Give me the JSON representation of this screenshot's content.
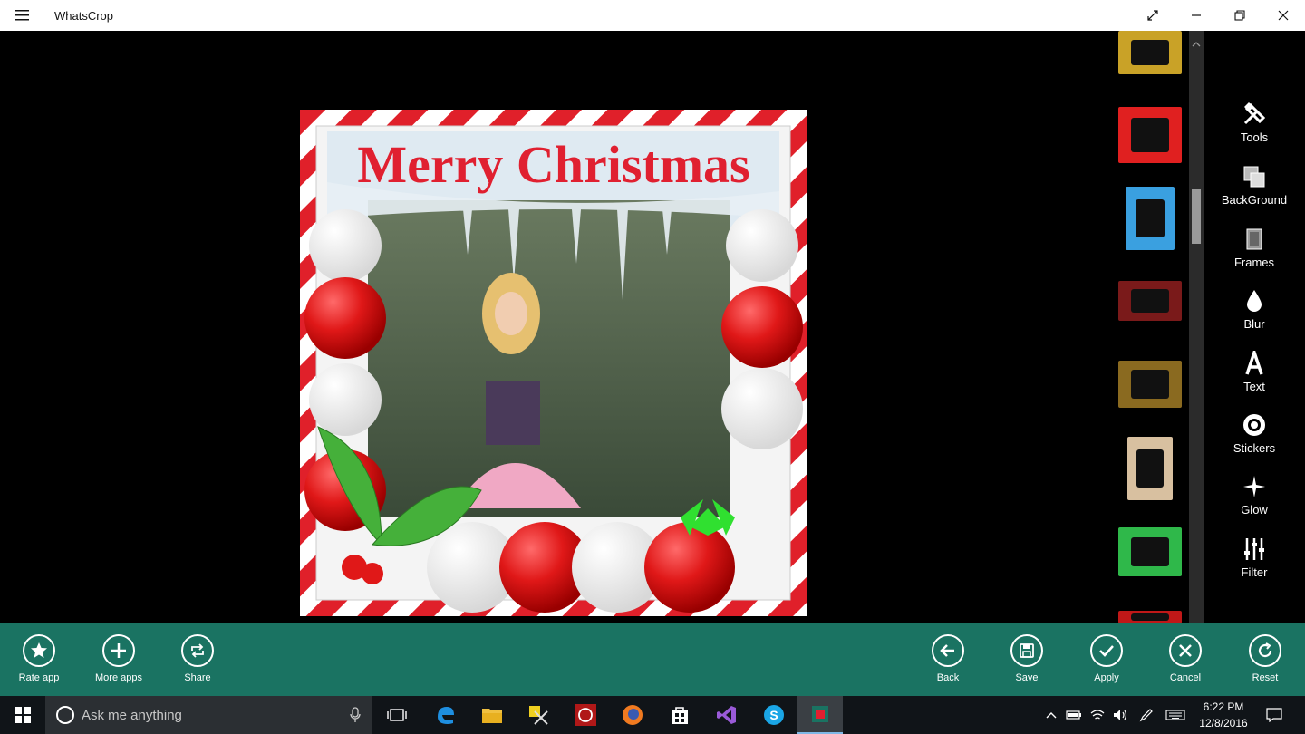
{
  "app": {
    "title": "WhatsCrop"
  },
  "photo": {
    "caption": "Merry Christmas"
  },
  "frames": {
    "thumbnails": [
      {
        "name": "gold-frame",
        "color": "#c9a227"
      },
      {
        "name": "merry-christmas-frame",
        "color": "#e02020"
      },
      {
        "name": "balloons-frame",
        "color": "#3aa0e0"
      },
      {
        "name": "holly-frame",
        "color": "#7a1a1a"
      },
      {
        "name": "ornate-gold-frame",
        "color": "#8a6a20"
      },
      {
        "name": "oval-frame",
        "color": "#d8c0a0"
      },
      {
        "name": "green-border-frame",
        "color": "#2fb84a"
      },
      {
        "name": "red-frame",
        "color": "#c01818"
      }
    ]
  },
  "tools": {
    "items": [
      {
        "label": "Tools",
        "icon": "tools-icon"
      },
      {
        "label": "BackGround",
        "icon": "background-icon"
      },
      {
        "label": "Frames",
        "icon": "frames-icon"
      },
      {
        "label": "Blur",
        "icon": "blur-icon"
      },
      {
        "label": "Text",
        "icon": "text-icon"
      },
      {
        "label": "Stickers",
        "icon": "stickers-icon"
      },
      {
        "label": "Glow",
        "icon": "glow-icon"
      },
      {
        "label": "Filter",
        "icon": "filter-icon"
      }
    ]
  },
  "appbar": {
    "left": [
      {
        "label": "Rate app",
        "icon": "star-icon"
      },
      {
        "label": "More apps",
        "icon": "plus-icon"
      },
      {
        "label": "Share",
        "icon": "share-icon"
      }
    ],
    "right": [
      {
        "label": "Back",
        "icon": "back-arrow-icon"
      },
      {
        "label": "Save",
        "icon": "save-icon"
      },
      {
        "label": "Apply",
        "icon": "check-icon"
      },
      {
        "label": "Cancel",
        "icon": "close-icon"
      },
      {
        "label": "Reset",
        "icon": "refresh-icon"
      }
    ],
    "color": "#1a7362"
  },
  "taskbar": {
    "search_placeholder": "Ask me anything",
    "time": "6:22 PM",
    "date": "12/8/2016"
  }
}
